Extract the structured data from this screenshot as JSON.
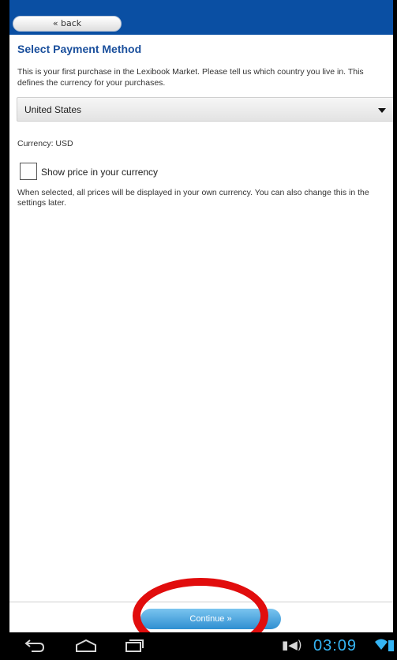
{
  "header": {
    "back_label": "« back"
  },
  "page": {
    "title": "Select Payment Method",
    "intro": "This is your first purchase in the Lexibook Market. Please tell us which country you live in. This defines the currency for your purchases.",
    "country_selected": "United States",
    "currency_text": "Currency: USD",
    "show_price_label": "Show price in your currency",
    "note": "When selected, all prices will be displayed in your own currency. You can also change this in the settings later."
  },
  "footer": {
    "continue_label": "Continue »"
  },
  "system_bar": {
    "time": "03:09"
  },
  "colors": {
    "header": "#0a4fa3",
    "title": "#1a4f9c",
    "continue": "#2f8fd1",
    "annotation": "#e10d0d",
    "clock": "#35b5f5"
  },
  "icons": [
    "back-nav-icon",
    "home-nav-icon",
    "recents-nav-icon",
    "wifi-icon",
    "battery-icon",
    "dropdown-arrow-icon"
  ]
}
